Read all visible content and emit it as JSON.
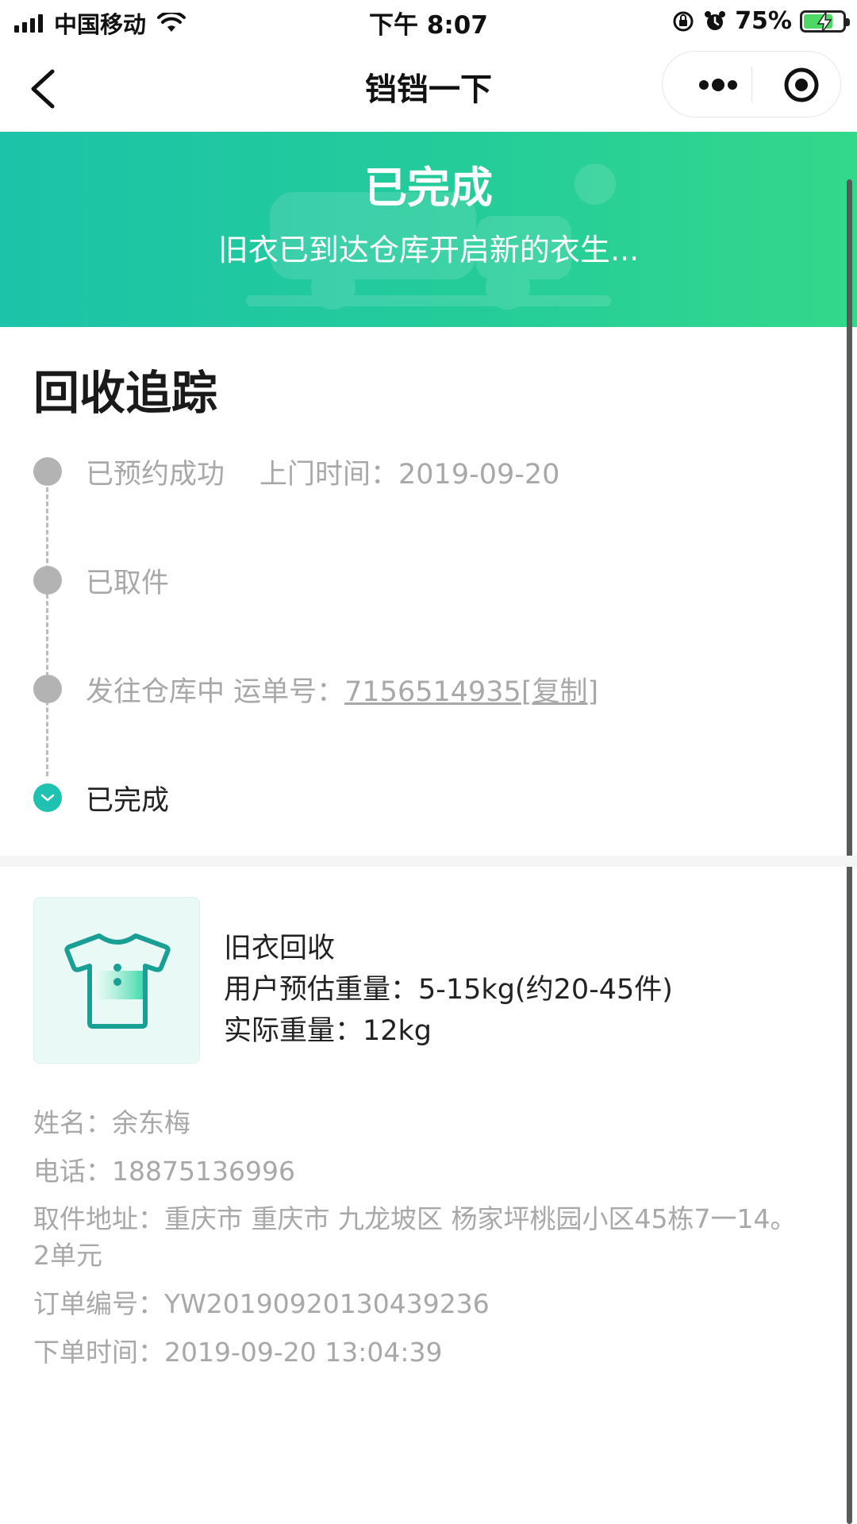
{
  "status_bar": {
    "carrier": "中国移动",
    "time": "下午 8:07",
    "battery_percent": "75%",
    "battery_level": 0.75
  },
  "nav": {
    "title": "铛铛一下"
  },
  "banner": {
    "title": "已完成",
    "subtitle": "旧衣已到达仓库开启新的衣生..."
  },
  "tracking": {
    "title": "回收追踪",
    "steps": [
      {
        "label": "已预约成功",
        "extra": "上门时间：2019-09-20"
      },
      {
        "label": "已取件"
      },
      {
        "label": "发往仓库中 运单号：",
        "waybill": "7156514935",
        "copy_label": "[复制]"
      },
      {
        "label": "已完成"
      }
    ]
  },
  "product": {
    "icon": "shirt-icon",
    "name": "旧衣回收",
    "estimated_weight": "用户预估重量：5-15kg(约20-45件)",
    "actual_weight": "实际重量：12kg"
  },
  "details": {
    "name": "姓名：余东梅",
    "phone": "电话：18875136996",
    "address_line1": "取件地址：重庆市 重庆市 九龙坡区 杨家坪桃园小区45栋7一14。",
    "address_line2": "2单元",
    "order_no": "订单编号：YW20190920130439236",
    "order_time": "下单时间：2019-09-20 13:04:39"
  },
  "colors": {
    "accent": "#1fc2b0",
    "banner_start": "#1cc3a8",
    "banner_end": "#33d88b",
    "muted_text": "#a8a8a8"
  }
}
